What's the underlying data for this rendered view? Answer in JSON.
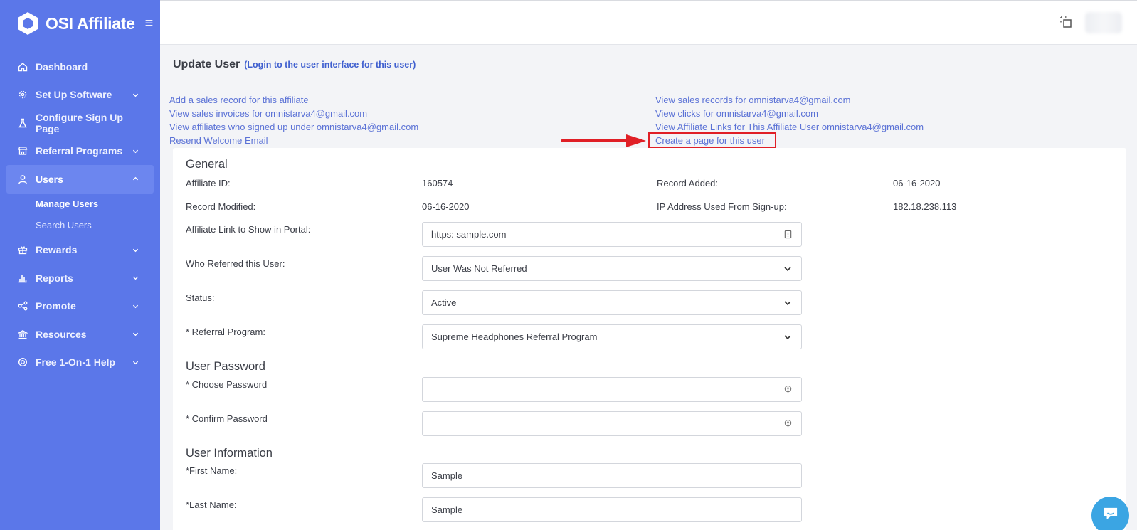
{
  "brand": {
    "name": "OSI Affiliate",
    "menu_icon": "hamburger-icon"
  },
  "sidebar": {
    "items": [
      {
        "label": "Dashboard",
        "icon": "home-icon",
        "has_chevron": false
      },
      {
        "label": "Set Up Software",
        "icon": "gear-icon",
        "has_chevron": true
      },
      {
        "label": "Configure Sign Up Page",
        "icon": "flask-icon",
        "has_chevron": false
      },
      {
        "label": "Referral Programs",
        "icon": "store-icon",
        "has_chevron": true
      },
      {
        "label": "Users",
        "icon": "user-icon",
        "has_chevron": true,
        "active": true
      },
      {
        "label": "Rewards",
        "icon": "gift-icon",
        "has_chevron": true
      },
      {
        "label": "Reports",
        "icon": "bar-chart-icon",
        "has_chevron": true
      },
      {
        "label": "Promote",
        "icon": "share-icon",
        "has_chevron": true
      },
      {
        "label": "Resources",
        "icon": "bank-icon",
        "has_chevron": true
      },
      {
        "label": "Free 1-On-1 Help",
        "icon": "lifebuoy-icon",
        "has_chevron": true
      }
    ],
    "subitems": [
      {
        "label": "Manage Users",
        "active": true
      },
      {
        "label": "Search Users",
        "active": false
      }
    ]
  },
  "header": {
    "title": "Update User",
    "login_link": "(Login to the user interface for this user)"
  },
  "links": {
    "left": [
      "Add a sales record for this affiliate",
      "View sales invoices for omnistarva4@gmail.com",
      "View affiliates who signed up under omnistarva4@gmail.com",
      "Resend Welcome Email"
    ],
    "right": [
      "View sales records for omnistarva4@gmail.com",
      "View clicks for omnistarva4@gmail.com",
      "View Affiliate Links for This Affiliate User omnistarva4@gmail.com",
      "Create a page for this user"
    ]
  },
  "general": {
    "section_title": "General",
    "affiliate_id_label": "Affiliate ID:",
    "affiliate_id": "160574",
    "record_added_label": "Record Added:",
    "record_added": "06-16-2020",
    "record_modified_label": "Record Modified:",
    "record_modified": "06-16-2020",
    "ip_label": "IP Address Used From Sign-up:",
    "ip": "182.18.238.113",
    "affiliate_link_label": "Affiliate Link to Show in Portal:",
    "affiliate_link_value": "https: sample.com",
    "referred_label": "Who Referred this User:",
    "referred_value": "User Was Not Referred",
    "status_label": "Status:",
    "status_value": "Active",
    "program_label": "* Referral Program:",
    "program_value": "Supreme Headphones Referral Program"
  },
  "password": {
    "section_title": "User Password",
    "choose_label": "* Choose Password",
    "choose_value": "",
    "confirm_label": "* Confirm Password",
    "confirm_value": ""
  },
  "user_info": {
    "section_title": "User Information",
    "first_name_label": "*First Name:",
    "first_name": "Sample",
    "last_name_label": "*Last Name:",
    "last_name": "Sample"
  },
  "colors": {
    "sidebar": "#5b77e9",
    "link": "#5b72d6",
    "highlight": "#e01f26",
    "chat": "#3ba5e3"
  }
}
